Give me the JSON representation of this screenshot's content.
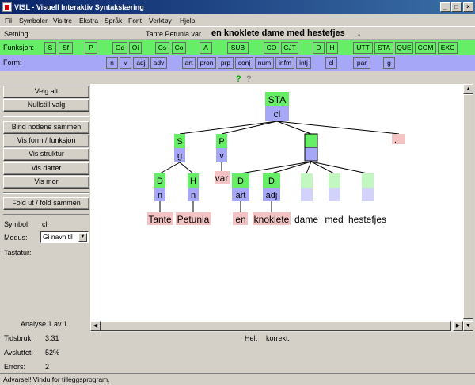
{
  "window": {
    "title": "VISL - Visuell Interaktiv Syntakslæring"
  },
  "menu": [
    "Fil",
    "Symboler",
    "Vis tre",
    "Ekstra",
    "Språk",
    "Font",
    "Verktøy",
    "Hjelp"
  ],
  "sentence": {
    "label": "Setning:",
    "given": "Tante Petunia var",
    "task": "en knoklete dame med hestefjes",
    "end": "."
  },
  "funksjon": {
    "label": "Funksjon:",
    "tags": [
      "S",
      "Sf",
      "P",
      "Od",
      "Oi",
      "Cs",
      "Co",
      "A",
      "SUB",
      "CO",
      "CJT",
      "D",
      "H",
      "UTT",
      "STA",
      "QUE",
      "COM",
      "EXC"
    ]
  },
  "form": {
    "label": "Form:",
    "tags": [
      "n",
      "v",
      "adj",
      "adv",
      "art",
      "pron",
      "prp",
      "conj",
      "num",
      "infm",
      "intj",
      "cl",
      "par",
      "g"
    ]
  },
  "help": {
    "green": "?",
    "gray": "?"
  },
  "buttons": {
    "select_all": "Velg alt",
    "reset": "Nullstill valg",
    "bind": "Bind nodene sammen",
    "show_form": "Vis form / funksjon",
    "show_struct": "Vis struktur",
    "show_daughter": "Vis datter",
    "show_mother": "Vis mor",
    "fold": "Fold ut / fold sammen"
  },
  "side": {
    "symbol_label": "Symbol:",
    "symbol_value": "cl",
    "modus_label": "Modus:",
    "modus_value": "Gi navn til",
    "tastatur_label": "Tastatur:"
  },
  "tree": {
    "root": {
      "func": "STA",
      "form": "cl"
    },
    "nodes": [
      {
        "func": "S",
        "form": "g"
      },
      {
        "func": "P",
        "form": "v"
      },
      {
        "func": "",
        "form": ""
      },
      {
        "func": ".",
        "form": ""
      },
      {
        "func": "D",
        "form": "n"
      },
      {
        "func": "H",
        "form": "n"
      },
      {
        "func": "D",
        "form": "art"
      },
      {
        "func": "D",
        "form": "adj"
      }
    ],
    "words": [
      "Tante",
      "Petunia",
      "var",
      "en",
      "knoklete",
      "dame",
      "med",
      "hestefjes"
    ]
  },
  "colors": {
    "func": "#66ee66",
    "form": "#a7a7f7",
    "word_done": "#f4c4c4",
    "func_pale": "#c2f7c2",
    "form_pale": "#d2d2fa"
  },
  "footer": {
    "analyse": "Analyse 1 av 1",
    "time_label": "Tidsbruk:",
    "time_value": "3:31",
    "done_label": "Avsluttet:",
    "done_value": "52%",
    "err_label": "Errors:",
    "err_value": "2",
    "result_a": "Helt",
    "result_b": "korrekt."
  },
  "status": "Advarsel! Vindu for tilleggsprogram."
}
